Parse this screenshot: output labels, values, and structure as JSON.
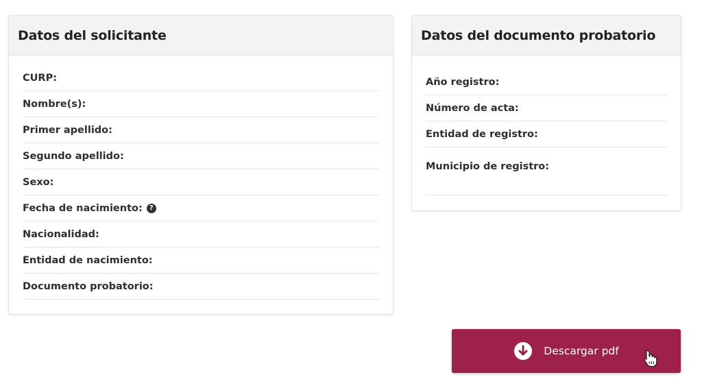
{
  "applicant_panel": {
    "title": "Datos del solicitante",
    "fields": [
      {
        "label": "CURP:"
      },
      {
        "label": "Nombre(s):"
      },
      {
        "label": "Primer apellido:"
      },
      {
        "label": "Segundo apellido:"
      },
      {
        "label": "Sexo:"
      },
      {
        "label": "Fecha de nacimiento:"
      },
      {
        "label": "Nacionalidad:"
      },
      {
        "label": "Entidad de nacimiento:"
      },
      {
        "label": "Documento probatorio:"
      }
    ]
  },
  "document_panel": {
    "title": "Datos del documento probatorio",
    "fields": [
      {
        "label": "Año registro:"
      },
      {
        "label": "Número de acta:"
      },
      {
        "label": "Entidad de registro:"
      },
      {
        "label": "Municipio de registro:"
      }
    ]
  },
  "download_button": {
    "label": "Descargar pdf",
    "icon": "download-circle-icon"
  },
  "help_icon": {
    "glyph": "?"
  },
  "colors": {
    "brand": "#9d2148",
    "header_bg": "#f3f3f3"
  }
}
